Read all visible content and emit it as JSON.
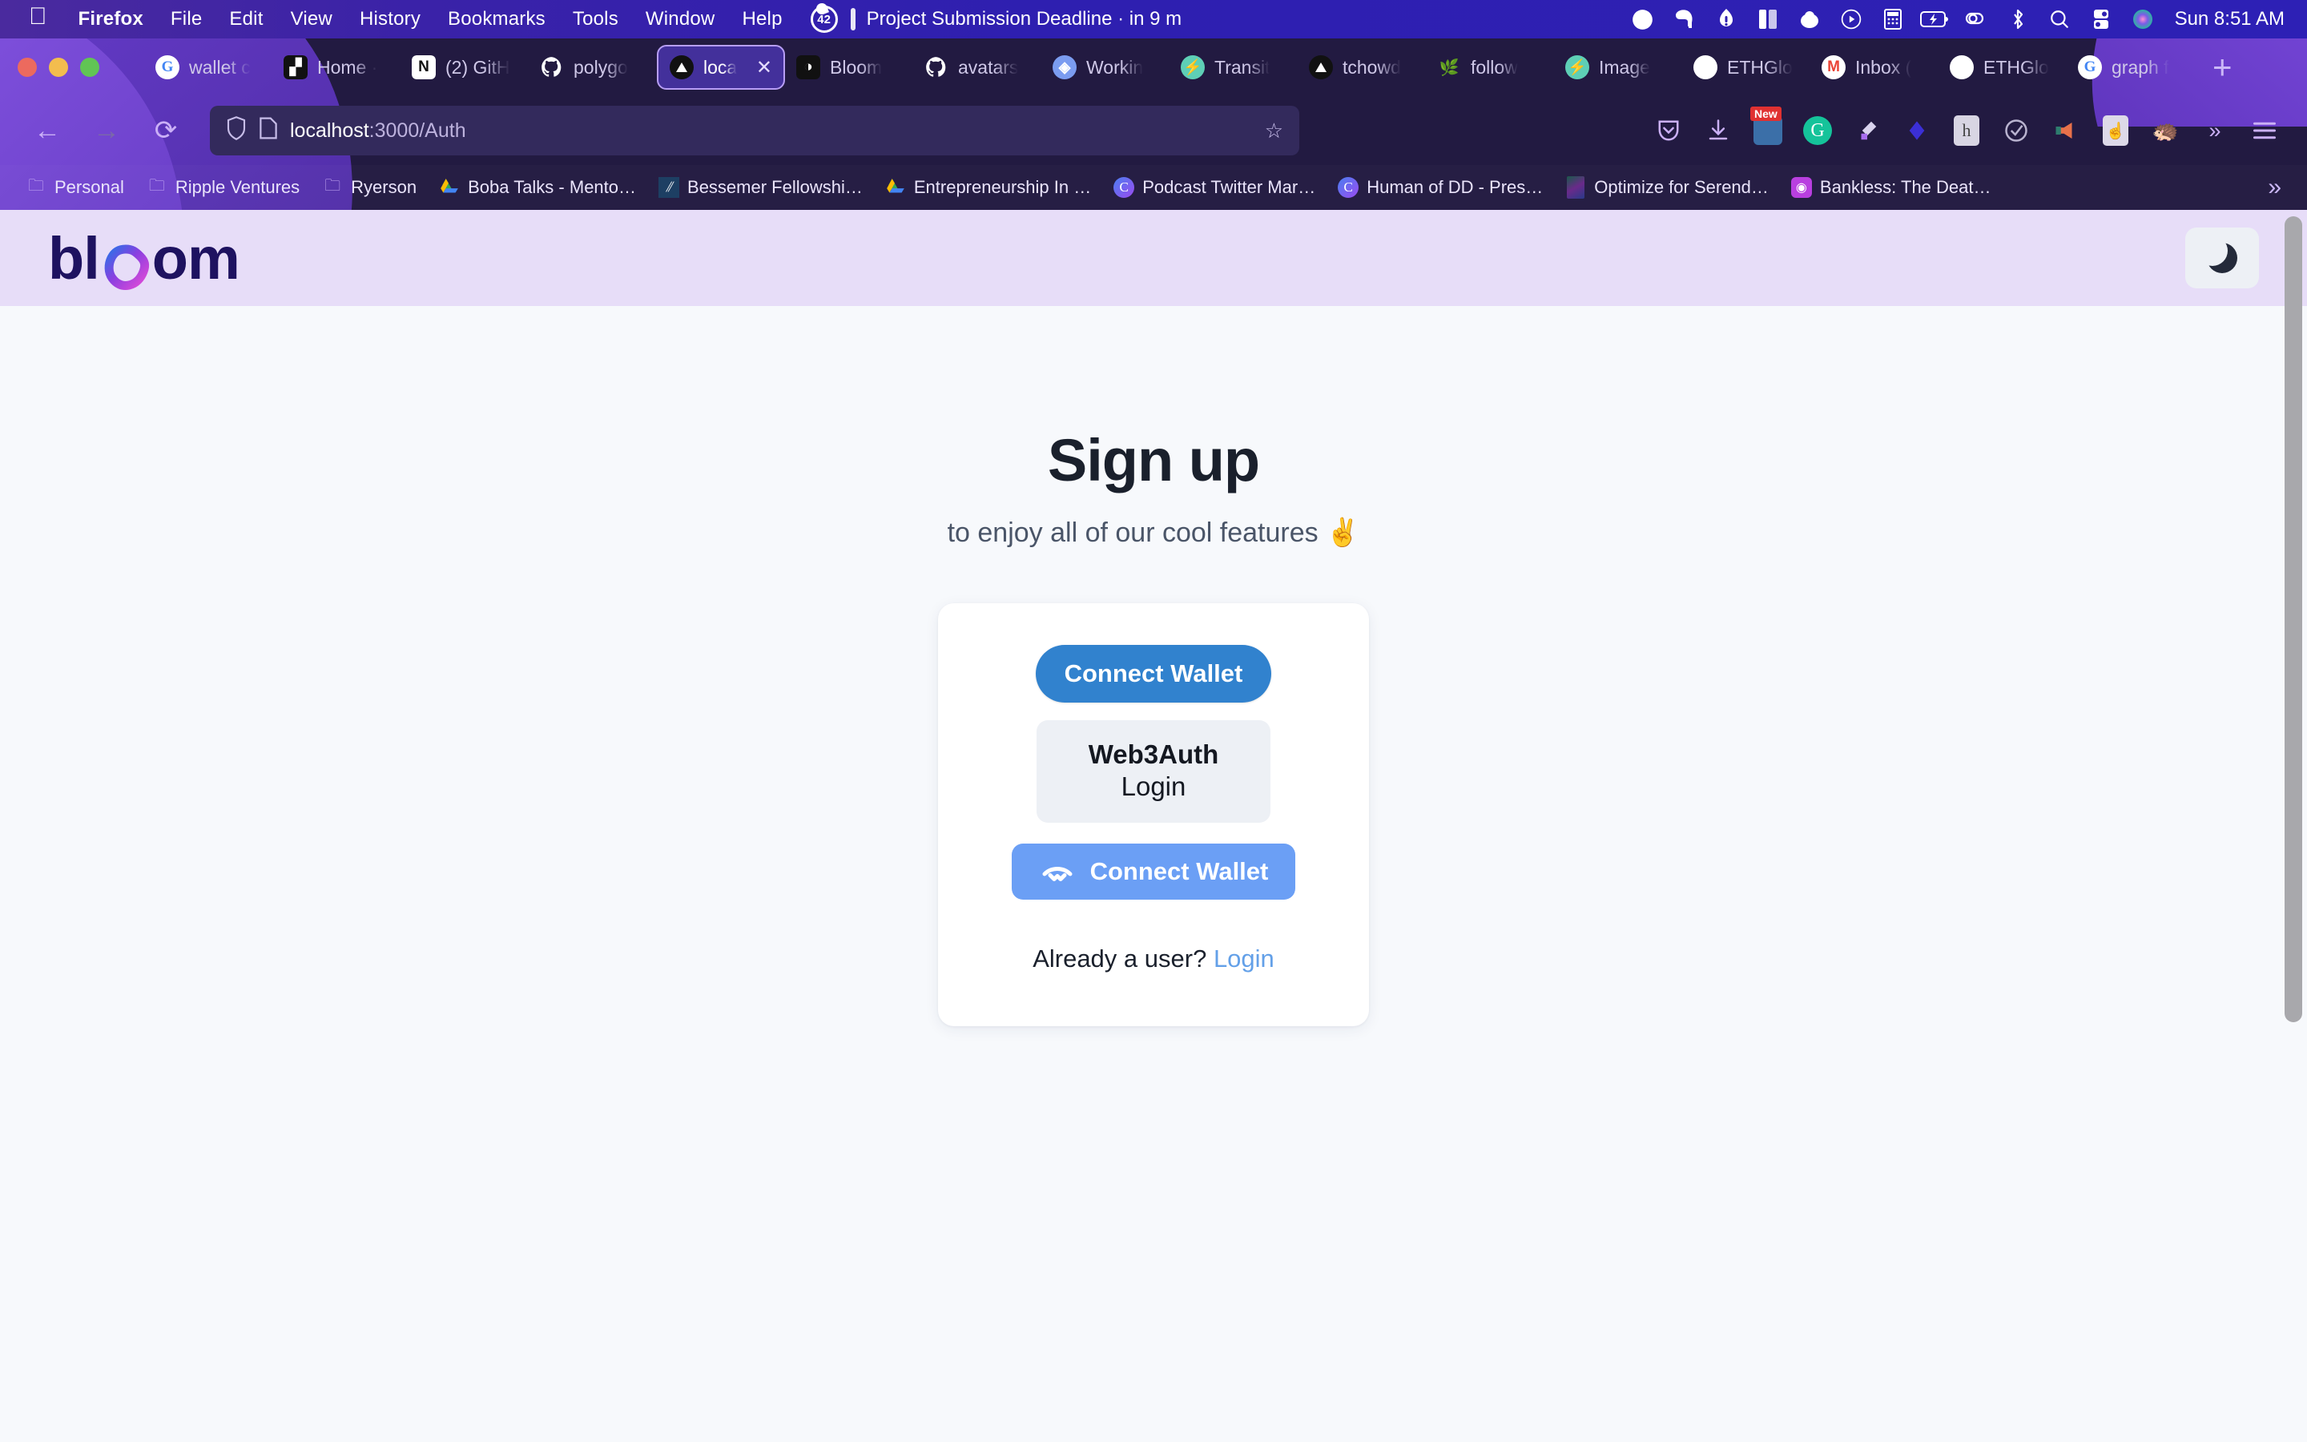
{
  "menubar": {
    "apple_icon": "apple-logo",
    "app_name": "Firefox",
    "items": [
      "File",
      "Edit",
      "View",
      "History",
      "Bookmarks",
      "Tools",
      "Window",
      "Help"
    ],
    "badge_count": "42",
    "event_text": "Project Submission Deadline · in 9 m",
    "status_icons": [
      "arc-browser-icon",
      "evernote-elephant-icon",
      "dropbox-icon",
      "rectangle-app-icon",
      "cloud-icon",
      "play-circle-icon",
      "calculator-icon",
      "battery-charging-icon",
      "link-chain-icon",
      "bluetooth-icon",
      "search-icon",
      "control-center-icon",
      "siri-orb-icon"
    ],
    "clock": "Sun 8:51 AM"
  },
  "browser": {
    "tabs": [
      {
        "label": "wallet c",
        "favicon": "google-icon",
        "active": false
      },
      {
        "label": "Home ·",
        "favicon": "figma-dark-icon",
        "active": false
      },
      {
        "label": "(2) GitH",
        "favicon": "notion-icon",
        "active": false
      },
      {
        "label": "polygo",
        "favicon": "github-icon",
        "active": false
      },
      {
        "label": "loca",
        "favicon": "vercel-icon",
        "active": true
      },
      {
        "label": "Bloom",
        "favicon": "figma-icon",
        "active": false
      },
      {
        "label": "avatars",
        "favicon": "github-icon",
        "active": false
      },
      {
        "label": "Workin",
        "favicon": "ethereum-icon",
        "active": false
      },
      {
        "label": "Transit",
        "favicon": "lightning-icon",
        "active": false
      },
      {
        "label": "tchowd",
        "favicon": "vercel-icon",
        "active": false
      },
      {
        "label": "follow",
        "favicon": "leaf-icon",
        "active": false
      },
      {
        "label": "Image",
        "favicon": "lightning-icon",
        "active": false
      },
      {
        "label": "ETHGlo",
        "favicon": "ethglobal-icon",
        "active": false
      },
      {
        "label": "Inbox (",
        "favicon": "gmail-icon",
        "active": false
      },
      {
        "label": "ETHGlo",
        "favicon": "ethglobal-icon",
        "active": false
      },
      {
        "label": "graph f",
        "favicon": "google-icon",
        "active": false
      }
    ],
    "new_tab_label": "+",
    "close_tab_label": "✕",
    "nav": {
      "back": "←",
      "forward": "→",
      "reload": "⟳"
    },
    "url": {
      "host": "localhost",
      "path": ":3000/Auth",
      "shield_icon": "shield-icon",
      "page_icon": "page-doc-icon",
      "bookmark_star": "star-icon"
    },
    "extensions": [
      "pocket-icon",
      "downloads-icon",
      "snap-new-icon",
      "grammarly-icon",
      "highlighter-icon",
      "diamond-icon",
      "hypothesis-icon",
      "check-circle-icon",
      "megaphone-icon",
      "pointer-icon",
      "hedgehog-icon",
      "overflow-chevrons-icon",
      "hamburger-menu-icon"
    ],
    "bookmarks": [
      {
        "label": "Personal",
        "icon": "folder-icon"
      },
      {
        "label": "Ripple Ventures",
        "icon": "folder-icon"
      },
      {
        "label": "Ryerson",
        "icon": "folder-icon"
      },
      {
        "label": "Boba Talks - Mento…",
        "icon": "google-drive-icon"
      },
      {
        "label": "Bessemer Fellowshi…",
        "icon": "bessemer-icon"
      },
      {
        "label": "Entrepreneurship In …",
        "icon": "google-drive-icon"
      },
      {
        "label": "Podcast Twitter Mar…",
        "icon": "circle-c-icon"
      },
      {
        "label": "Human of DD - Pres…",
        "icon": "circle-c-icon"
      },
      {
        "label": "Optimize for Serend…",
        "icon": "art-thumbnail-icon"
      },
      {
        "label": "Bankless: The Deat…",
        "icon": "podcast-icon"
      }
    ],
    "bookmarks_overflow": "»"
  },
  "page": {
    "header": {
      "logo_part1": "bl",
      "logo_hex": "hexagon-gradient-icon",
      "logo_part2": "om",
      "theme_toggle_icon": "moon-icon"
    },
    "title": "Sign up",
    "subtitle": "to enjoy all of our cool features ✌️",
    "card": {
      "connect_wallet_primary": "Connect Wallet",
      "web3auth_title": "Web3Auth",
      "web3auth_subtitle": "Login",
      "walletconnect_label": "Connect Wallet",
      "walletconnect_icon": "walletconnect-icon",
      "footer_text": "Already a user?",
      "footer_link": "Login"
    }
  },
  "colors": {
    "menubar_purple": "#2e1fb0",
    "chrome_dark": "#221a41",
    "accent_blue": "#3182ce",
    "walletconnect_blue": "#6b9ff5",
    "header_lavender": "#e7ddf8",
    "page_bg": "#f7f9fc",
    "logo_navy": "#1e1260",
    "link_blue": "#63a0e8"
  }
}
